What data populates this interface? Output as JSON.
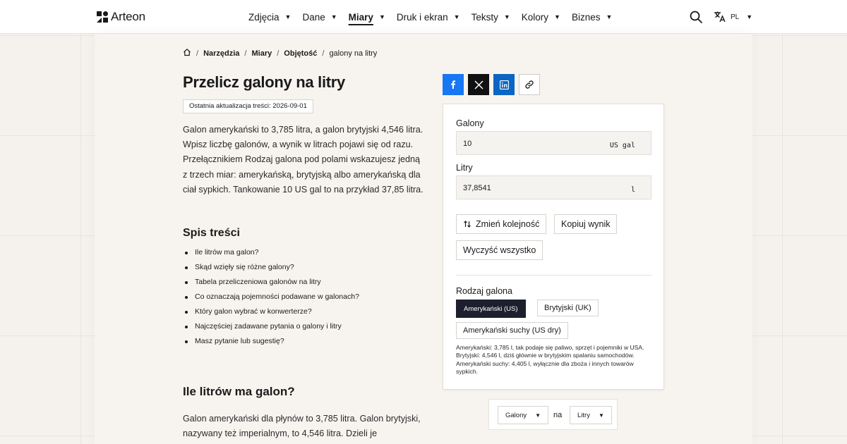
{
  "brand": {
    "name": "Arteon"
  },
  "nav": {
    "items": [
      {
        "label": "Zdjęcia",
        "active": false
      },
      {
        "label": "Dane",
        "active": false
      },
      {
        "label": "Miary",
        "active": true
      },
      {
        "label": "Druk i ekran",
        "active": false
      },
      {
        "label": "Teksty",
        "active": false
      },
      {
        "label": "Kolory",
        "active": false
      },
      {
        "label": "Biznes",
        "active": false
      }
    ],
    "lang": "PL"
  },
  "breadcrumb": [
    "Narzędzia",
    "Miary",
    "Objętość",
    "galony na litry"
  ],
  "page": {
    "title": "Przelicz galony na litry",
    "updated": "Ostatnia aktualizacja treści: 2026-09-01",
    "intro": "Galon amerykański to 3,785 litra, a galon brytyjski 4,546 litra. Wpisz liczbę galonów, a wynik w litrach pojawi się od razu. Przełącznikiem Rodzaj galona pod polami wskazujesz jedną z trzech miar: amerykańską, brytyjską albo amerykańską dla ciał sypkich. Tankowanie 10 US gal to na przykład 37,85 litra.",
    "toc_title": "Spis treści",
    "toc": [
      "Ile litrów ma galon?",
      "Skąd wzięły się różne galony?",
      "Tabela przeliczeniowa galonów na litry",
      "Co oznaczają pojemności podawane w galonach?",
      "Który galon wybrać w konwerterze?",
      "Najczęściej zadawane pytania o galony i litry",
      "Masz pytanie lub sugestię?"
    ],
    "section_title": "Ile litrów ma galon?",
    "section_text": "Galon amerykański dla płynów to 3,785 litra. Galon brytyjski, nazywany też imperialnym, to 4,546 litra. Dzieli je"
  },
  "converter": {
    "from_label": "Galony",
    "from_value": "10",
    "from_unit": "US gal",
    "to_label": "Litry",
    "to_value": "37,8541",
    "to_unit": "l",
    "swap_label": "Zmień kolejność",
    "copy_label": "Kopiuj wynik",
    "clear_label": "Wyczyść wszystko",
    "type_label": "Rodzaj galona",
    "types": [
      "Amerykański (US)",
      "Brytyjski (UK)",
      "Amerykański suchy (US dry)"
    ],
    "selected_type": "Amerykański (US)",
    "note": "Amerykański: 3,785 l, tak podaje się paliwo, sprzęt i pojemniki w USA. Brytyjski: 4,546 l, dziś głównie w brytyjskim spalaniu samochodów. Amerykański suchy: 4,405 l, wyłącznie dla zboża i innych towarów sypkich."
  },
  "selector": {
    "from": "Galony",
    "joiner": "na",
    "to": "Litry"
  },
  "colors": {
    "accent": "#1e1f2e",
    "facebook": "#1877f2",
    "linkedin": "#0a66c2"
  }
}
